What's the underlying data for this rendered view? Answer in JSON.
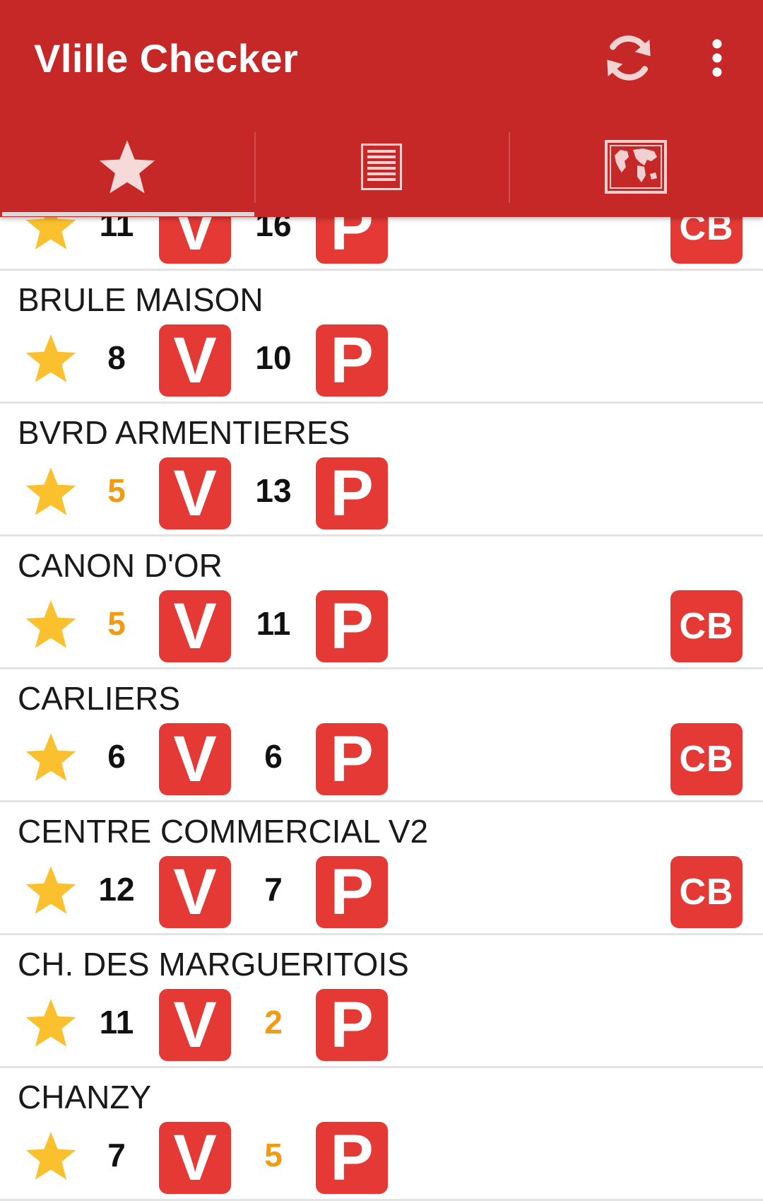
{
  "app": {
    "title": "Vlille Checker",
    "accent_color": "#c62828",
    "badge_color": "#e53935",
    "star_color": "#fbc02d",
    "low_count_color": "#f29a12"
  },
  "toolbar": {
    "refresh_icon": "refresh-icon",
    "overflow_icon": "more-vert-icon"
  },
  "tabs": [
    {
      "id": "favorites",
      "icon": "star-icon",
      "selected": true
    },
    {
      "id": "list",
      "icon": "list-icon",
      "selected": false
    },
    {
      "id": "map",
      "icon": "map-icon",
      "selected": false
    }
  ],
  "legend": {
    "bikes_badge": "V",
    "slots_badge": "P",
    "card_badge": "CB"
  },
  "stations": [
    {
      "name": "",
      "bikes": "11",
      "slots": "16",
      "bikes_low": false,
      "slots_low": false,
      "cb": true
    },
    {
      "name": "BRULE MAISON",
      "bikes": "8",
      "slots": "10",
      "bikes_low": false,
      "slots_low": false,
      "cb": false
    },
    {
      "name": "BVRD ARMENTIERES",
      "bikes": "5",
      "slots": "13",
      "bikes_low": true,
      "slots_low": false,
      "cb": false
    },
    {
      "name": "CANON D'OR",
      "bikes": "5",
      "slots": "11",
      "bikes_low": true,
      "slots_low": false,
      "cb": true
    },
    {
      "name": "CARLIERS",
      "bikes": "6",
      "slots": "6",
      "bikes_low": false,
      "slots_low": false,
      "cb": true
    },
    {
      "name": "CENTRE COMMERCIAL V2",
      "bikes": "12",
      "slots": "7",
      "bikes_low": false,
      "slots_low": false,
      "cb": true
    },
    {
      "name": "CH. DES MARGUERITOIS",
      "bikes": "11",
      "slots": "2",
      "bikes_low": false,
      "slots_low": true,
      "cb": false
    },
    {
      "name": "CHANZY",
      "bikes": "7",
      "slots": "5",
      "bikes_low": false,
      "slots_low": true,
      "cb": false
    }
  ]
}
